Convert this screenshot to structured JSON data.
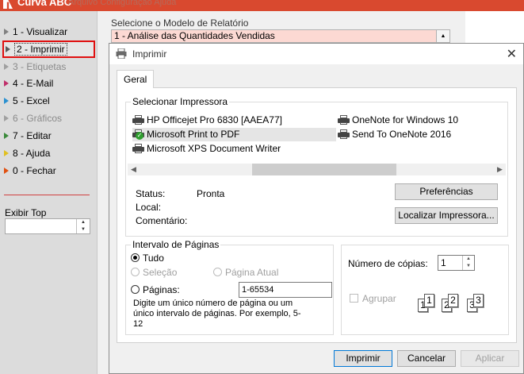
{
  "app": {
    "title": "Curva ABC",
    "menu_faint": "Arquivo   Configuração   Ajuda"
  },
  "sidebar": {
    "items": [
      {
        "label": "1 - Visualizar",
        "state": "normal"
      },
      {
        "label": "2 - Imprimir",
        "state": "selected"
      },
      {
        "label": "3 - Etiquetas",
        "state": "disabled"
      },
      {
        "label": "4 - E-Mail",
        "state": "normal"
      },
      {
        "label": "5 - Excel",
        "state": "normal"
      },
      {
        "label": "6 - Gráficos",
        "state": "disabled"
      },
      {
        "label": "7 - Editar",
        "state": "normal"
      },
      {
        "label": "8 - Ajuda",
        "state": "normal"
      },
      {
        "label": "0 - Fechar",
        "state": "normal"
      }
    ],
    "item_colors": [
      "#808080",
      "#5a5a5a",
      "#a0a0a0",
      "#c0306a",
      "#2a90d0",
      "#a0a0a0",
      "#3a8a3a",
      "#e0c020",
      "#e05010"
    ],
    "exibir_top_label": "Exibir Top",
    "exibir_top_value": ""
  },
  "report": {
    "model_label": "Selecione o Modelo de Relatório",
    "model_value": "1 - Análise das Quantidades Vendidas"
  },
  "dialog": {
    "title": "Imprimir",
    "tab": "Geral",
    "printer_group_label": "Selecionar Impressora",
    "printers": [
      {
        "name": "HP Officejet Pro 6830 [AAEA77]",
        "selected": false,
        "default": false
      },
      {
        "name": "Microsoft Print to PDF",
        "selected": true,
        "default": true
      },
      {
        "name": "Microsoft XPS Document Writer",
        "selected": false,
        "default": false
      },
      {
        "name": "OneNote for Windows 10",
        "selected": false,
        "default": false
      },
      {
        "name": "Send To OneNote 2016",
        "selected": false,
        "default": false
      }
    ],
    "status_label": "Status:",
    "status_value": "Pronta",
    "local_label": "Local:",
    "local_value": "",
    "comment_label": "Comentário:",
    "comment_value": "",
    "preferences_button": "Preferências",
    "find_printer_button": "Localizar Impressora...",
    "page_range_label": "Intervalo de Páginas",
    "range_all": "Tudo",
    "range_selection": "Seleção",
    "range_current": "Página Atual",
    "range_pages": "Páginas:",
    "pages_value": "1-65534",
    "pages_hint": "Digite um único número de página ou um único intervalo de páginas. Por exemplo, 5-12",
    "copies_label": "Número de cópias:",
    "copies_value": "1",
    "collate_label": "Agrupar",
    "collate_pages": [
      "1",
      "1",
      "2",
      "2",
      "3",
      "3"
    ],
    "print_button": "Imprimir",
    "cancel_button": "Cancelar",
    "apply_button": "Aplicar"
  }
}
